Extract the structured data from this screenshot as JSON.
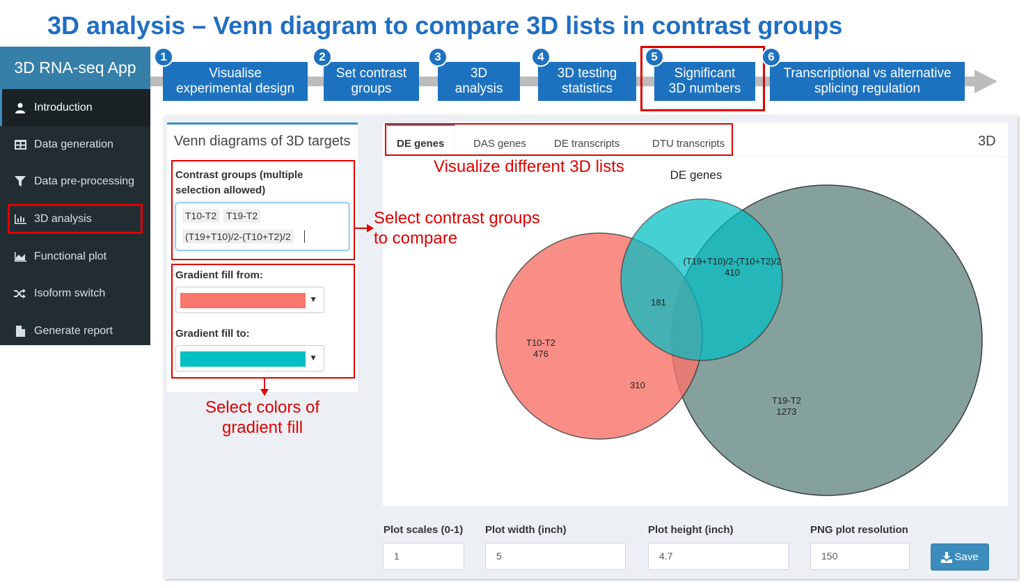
{
  "title": "3D analysis – Venn diagram to compare 3D lists in contrast groups",
  "sidebar": {
    "app_title": "3D RNA-seq App",
    "items": [
      {
        "label": "Introduction",
        "icon": "user-icon"
      },
      {
        "label": "Data generation",
        "icon": "table-icon"
      },
      {
        "label": "Data pre-processing",
        "icon": "filter-icon"
      },
      {
        "label": "3D analysis",
        "icon": "bar-chart-icon"
      },
      {
        "label": "Functional plot",
        "icon": "area-chart-icon"
      },
      {
        "label": "Isoform switch",
        "icon": "random-icon"
      },
      {
        "label": "Generate report",
        "icon": "file-icon"
      }
    ]
  },
  "steps": [
    {
      "num": "1",
      "line1": "Visualise",
      "line2": "experimental design"
    },
    {
      "num": "2",
      "line1": "Set contrast",
      "line2": "groups"
    },
    {
      "num": "3",
      "line1": "3D",
      "line2": "analysis"
    },
    {
      "num": "4",
      "line1": "3D testing",
      "line2": "statistics"
    },
    {
      "num": "5",
      "line1": "Significant",
      "line2": "3D numbers"
    },
    {
      "num": "6",
      "line1": "Transcriptional vs alternative",
      "line2": "splicing regulation"
    }
  ],
  "left_panel": {
    "title": "Venn diagrams of 3D targets",
    "contrast_label_1": "Contrast groups (multiple",
    "contrast_label_2": "selection allowed)",
    "chips": [
      "T10-T2",
      "T19-T2",
      "(T19+T10)/2-(T10+T2)/2"
    ],
    "gradient_from_label": "Gradient fill from:",
    "gradient_from_color": "#f8766d",
    "gradient_to_label": "Gradient fill to:",
    "gradient_to_color": "#00bfc4"
  },
  "tabs": {
    "items": [
      "DE genes",
      "DAS genes",
      "DE transcripts",
      "DTU transcripts"
    ],
    "active": "DE genes",
    "right_label": "3D"
  },
  "venn": {
    "title": "DE genes",
    "sets": [
      {
        "name": "T10-T2",
        "only": "476",
        "color": "#f8766d"
      },
      {
        "name": "T19-T2",
        "only": "1273",
        "color": "#7f9d98"
      },
      {
        "name": "(T19+T10)/2-(T10+T2)/2",
        "only": "410",
        "color": "#00bfc4"
      }
    ],
    "overlap_all_three": "181",
    "overlap_t10_t19": "310"
  },
  "bottom": {
    "scale_label": "Plot scales (0-1)",
    "scale_value": "1",
    "width_label": "Plot width (inch)",
    "width_value": "5",
    "height_label": "Plot height (inch)",
    "height_value": "4.7",
    "res_label": "PNG plot resolution",
    "res_value": "150",
    "save_label": "Save"
  },
  "annotations": {
    "lists": "Visualize different 3D lists",
    "contrast_1": "Select contrast groups",
    "contrast_2": "to compare",
    "colors_1": "Select colors of",
    "colors_2": "gradient fill"
  },
  "colors": {
    "accent": "#1d72c0",
    "sidebar": "#222d32",
    "annotation": "#e00000"
  }
}
